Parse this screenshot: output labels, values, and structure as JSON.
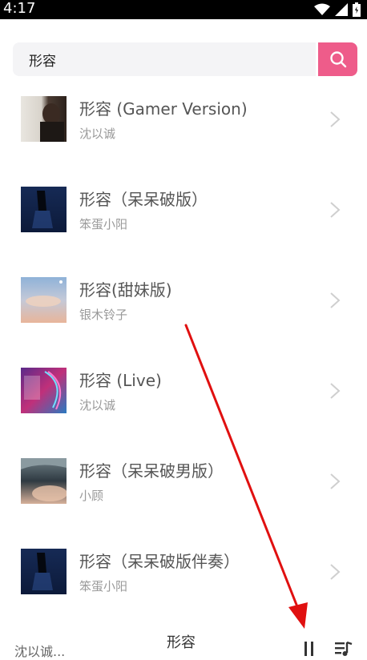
{
  "status": {
    "time": "4:17"
  },
  "search": {
    "value": "形容"
  },
  "results": [
    {
      "title": "形容 (Gamer Version)",
      "artist": "沈以诚"
    },
    {
      "title": "形容（呆呆破版）",
      "artist": "笨蛋小阳"
    },
    {
      "title": "形容(甜妹版)",
      "artist": "银木铃子"
    },
    {
      "title": "形容 (Live)",
      "artist": "沈以诚"
    },
    {
      "title": "形容（呆呆破男版）",
      "artist": "小顾"
    },
    {
      "title": "形容（呆呆破版伴奏）",
      "artist": "笨蛋小阳"
    }
  ],
  "player": {
    "artist": "沈以诚...",
    "song": "形容"
  },
  "colors": {
    "accent": "#ee5c8a",
    "annotation_arrow": "#e01010"
  }
}
